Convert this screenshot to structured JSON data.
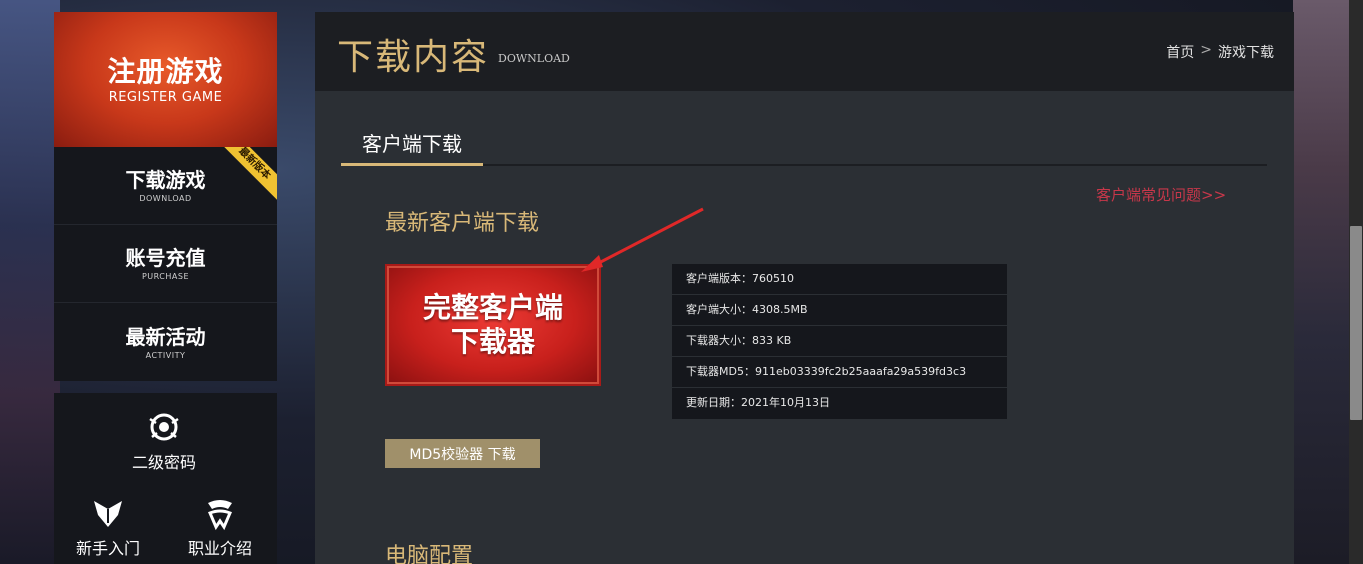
{
  "sidebar": {
    "register": {
      "title": "注册游戏",
      "subtitle": "REGISTER GAME"
    },
    "nav": [
      {
        "title": "下载游戏",
        "subtitle": "DOWNLOAD",
        "ribbon": "最新版本"
      },
      {
        "title": "账号充值",
        "subtitle": "PURCHASE"
      },
      {
        "title": "最新活动",
        "subtitle": "ACTIVITY"
      }
    ],
    "tools": [
      {
        "label": "二级密码",
        "icon": "lock-eye-icon"
      },
      {
        "label": "新手入门",
        "icon": "wing-emblem-icon"
      },
      {
        "label": "职业介绍",
        "icon": "claw-emblem-icon"
      }
    ]
  },
  "main": {
    "title": "下载内容",
    "title_en": "DOWNLOAD",
    "breadcrumb": {
      "home": "首页",
      "separator": ">",
      "current": "游戏下载"
    },
    "tab": "客户端下载",
    "faq_link": "客户端常见问题>>",
    "section_latest": "最新客户端下载",
    "download_button": {
      "line1": "完整客户端",
      "line2": "下载器"
    },
    "info": [
      "客户端版本：760510",
      "客户端大小：4308.5MB",
      "下载器大小：833 KB",
      "下载器MD5：911eb03339fc2b25aaafa29a539fd3c3",
      "更新日期：2021年10月13日"
    ],
    "md5_button": "MD5校验器 下载",
    "section_pc": "电脑配置"
  },
  "colors": {
    "accent_gold": "#d8b878",
    "download_red": "#c8201c",
    "faq_red": "#c8374a",
    "ribbon_yellow": "#f0c232"
  }
}
